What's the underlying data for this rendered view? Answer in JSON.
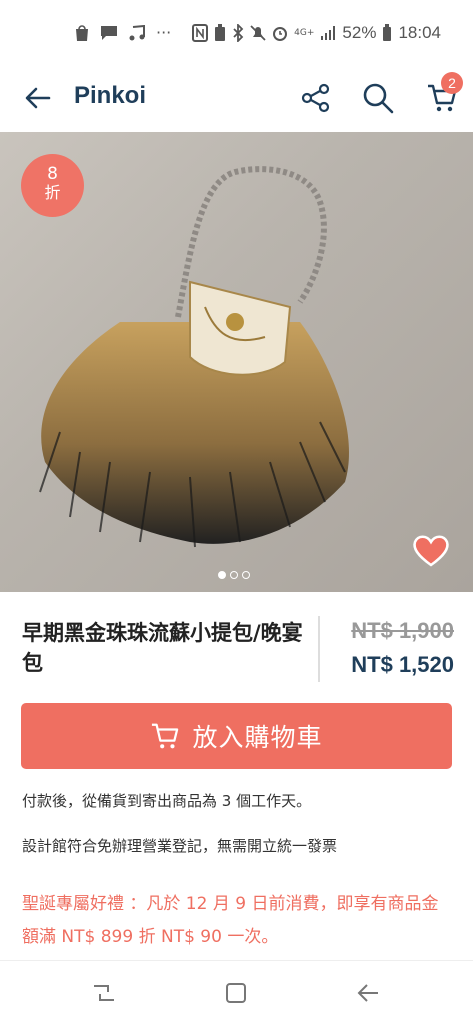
{
  "status_bar": {
    "left_icons": [
      "shop-icon",
      "chat-icon",
      "music-icon",
      "more-icon"
    ],
    "more_glyph": "···",
    "network": "4G+",
    "battery": "52%",
    "time": "18:04"
  },
  "app_bar": {
    "title": "Pinkoi",
    "cart_count": "2"
  },
  "product": {
    "discount_number": "8",
    "discount_unit": "折",
    "title": "早期黑金珠珠流蘇小提包/晚宴包",
    "original_price": "NT$ 1,900",
    "sale_price": "NT$ 1,520",
    "image_count": 3,
    "active_image": 0
  },
  "actions": {
    "add_to_cart": "放入購物車"
  },
  "notes": {
    "shipping": "付款後，從備貨到寄出商品為 3 個工作天。",
    "invoice": "設計館符合免辦理營業登記，無需開立統一發票",
    "promo": "聖誕專屬好禮 ：凡於 12 月 9 日前消費，即享有商品金額滿 NT$ 899 折 NT$ 90 一次。"
  },
  "colors": {
    "accent": "#ef6f61",
    "brand": "#1f3e5a"
  }
}
